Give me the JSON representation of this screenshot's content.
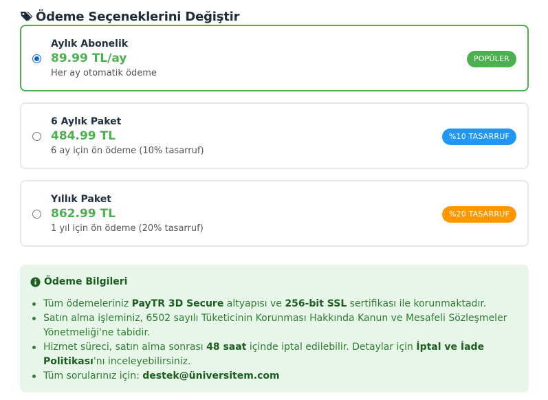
{
  "header": {
    "icon": "tags-icon",
    "title": "Ödeme Seçeneklerini Değiştir"
  },
  "options": [
    {
      "name": "Aylık Abonelik",
      "price": "89.99 TL/ay",
      "description": "Her ay otomatik ödeme",
      "badge": "POPÜLER",
      "badge_color": "#4caf50",
      "selected": true
    },
    {
      "name": "6 Aylık Paket",
      "price": "484.99 TL",
      "description": "6 ay için ön ödeme (10% tasarruf)",
      "badge": "%10 TASARRUF",
      "badge_color": "#2196f3",
      "selected": false
    },
    {
      "name": "Yıllık Paket",
      "price": "862.99 TL",
      "description": "1 yıl için ön ödeme (20% tasarruf)",
      "badge": "%20 TASARRUF",
      "badge_color": "#ff9800",
      "selected": false
    }
  ],
  "info": {
    "icon": "info-circle-icon",
    "title": "Ödeme Bilgileri",
    "items": [
      {
        "t1": "Tüm ödemeleriniz ",
        "b1": "PayTR 3D Secure",
        "t2": " altyapısı ve ",
        "b2": "256-bit SSL",
        "t3": " sertifikası ile korunmaktadır."
      },
      {
        "t1": "Satın alma işleminiz, 6502 sayılı Tüketicinin Korunması Hakkında Kanun ve Mesafeli Sözleşmeler Yönetmeliği'ne tabidir."
      },
      {
        "t1": "Hizmet süreci, satın alma sonrası ",
        "b1": "48 saat",
        "t2": " içinde iptal edilebilir. Detaylar için ",
        "b2": "İptal ve İade Politikası",
        "t3": "'nı inceleyebilirsiniz."
      },
      {
        "t1": "Tüm sorularınız için: ",
        "b1": "destek@üniversitem.com"
      }
    ]
  },
  "colors": {
    "accent_green": "#4caf50",
    "info_bg": "#e8f5e9",
    "radio_checked": "#0a66d8"
  }
}
